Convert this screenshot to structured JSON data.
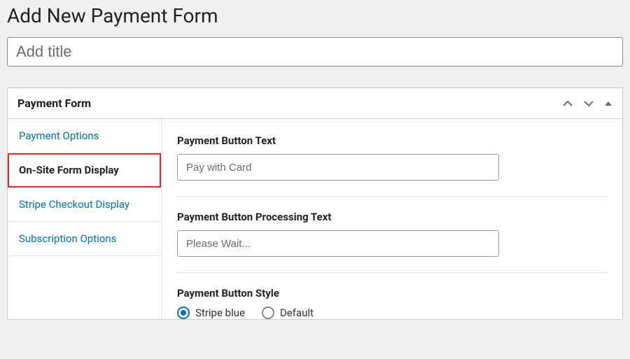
{
  "page": {
    "heading": "Add New Payment Form",
    "title_placeholder": "Add title",
    "title_value": ""
  },
  "metabox": {
    "title": "Payment Form",
    "tabs": [
      {
        "label": "Payment Options",
        "active": false
      },
      {
        "label": "On-Site Form Display",
        "active": true
      },
      {
        "label": "Stripe Checkout Display",
        "active": false
      },
      {
        "label": "Subscription Options",
        "active": false
      }
    ]
  },
  "fields": {
    "button_text": {
      "label": "Payment Button Text",
      "placeholder": "Pay with Card",
      "value": ""
    },
    "processing_text": {
      "label": "Payment Button Processing Text",
      "placeholder": "Please Wait...",
      "value": ""
    },
    "button_style": {
      "label": "Payment Button Style",
      "options": [
        {
          "label": "Stripe blue",
          "selected": true
        },
        {
          "label": "Default",
          "selected": false
        }
      ]
    }
  },
  "colors": {
    "link": "#0073aa",
    "highlight_border": "#d92c2c"
  }
}
